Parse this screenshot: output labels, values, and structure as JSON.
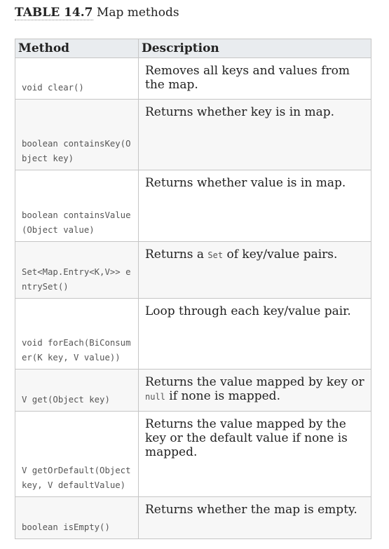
{
  "caption": {
    "label": "TABLE 14.7",
    "title": "Map methods"
  },
  "columns": {
    "method": "Method",
    "description": "Description"
  },
  "rows": [
    {
      "method": "void clear()",
      "desc_pre": "Removes all keys and values from the map.",
      "desc_code": "",
      "desc_post": ""
    },
    {
      "method": "boolean containsKey(Object key)",
      "desc_pre": "Returns whether key is in map.",
      "desc_code": "",
      "desc_post": ""
    },
    {
      "method": "boolean containsValue(Object value)",
      "desc_pre": "Returns whether value is in map.",
      "desc_code": "",
      "desc_post": ""
    },
    {
      "method": "Set<Map.Entry<K,V>> entrySet()",
      "desc_pre": "Returns a ",
      "desc_code": "Set",
      "desc_post": " of key/value pairs."
    },
    {
      "method": "void forEach(BiConsumer(K key, V value))",
      "desc_pre": "Loop through each key/value pair.",
      "desc_code": "",
      "desc_post": ""
    },
    {
      "method": "V get(Object key)",
      "desc_pre": "Returns the value mapped by key or ",
      "desc_code": "null",
      "desc_post": " if none is mapped."
    },
    {
      "method": "V getOrDefault(Object key, V defaultValue)",
      "desc_pre": "Returns the value mapped by the key or the default value if none is mapped.",
      "desc_code": "",
      "desc_post": ""
    },
    {
      "method": "boolean isEmpty()",
      "desc_pre": "Returns whether the map is empty.",
      "desc_code": "",
      "desc_post": ""
    }
  ]
}
